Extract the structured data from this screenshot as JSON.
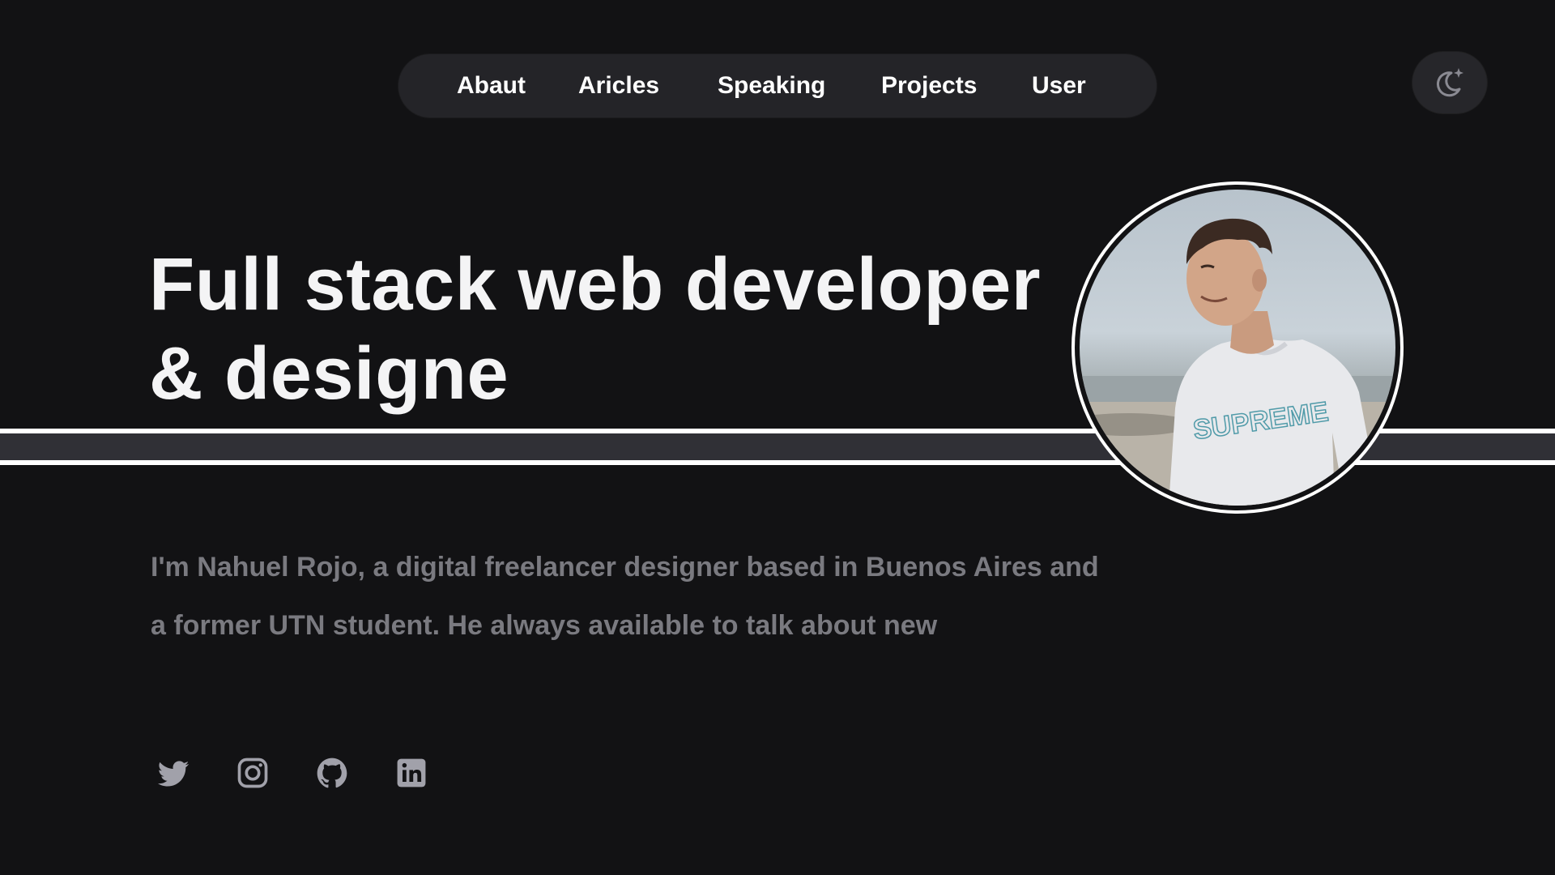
{
  "nav": {
    "items": [
      {
        "label": "Abaut"
      },
      {
        "label": "Aricles"
      },
      {
        "label": "Speaking"
      },
      {
        "label": "Projects"
      },
      {
        "label": "User"
      }
    ]
  },
  "theme_toggle": {
    "icon": "moon-sparkle-icon"
  },
  "hero": {
    "title_line1": "Full stack web developer",
    "title_line2": "& designe",
    "bio_line1": "I'm Nahuel Rojo, a digital freelancer designer based in Buenos Aires and",
    "bio_line2": "a former UTN student. He always available to talk about new"
  },
  "social": [
    {
      "icon": "twitter-icon"
    },
    {
      "icon": "instagram-icon"
    },
    {
      "icon": "github-icon"
    },
    {
      "icon": "linkedin-icon"
    }
  ],
  "colors": {
    "background": "#121214",
    "nav_background": "#242428",
    "text_primary": "#f4f4f5",
    "text_muted": "#7a7a80",
    "icon": "#a1a1aa",
    "stripe": "#303036"
  }
}
